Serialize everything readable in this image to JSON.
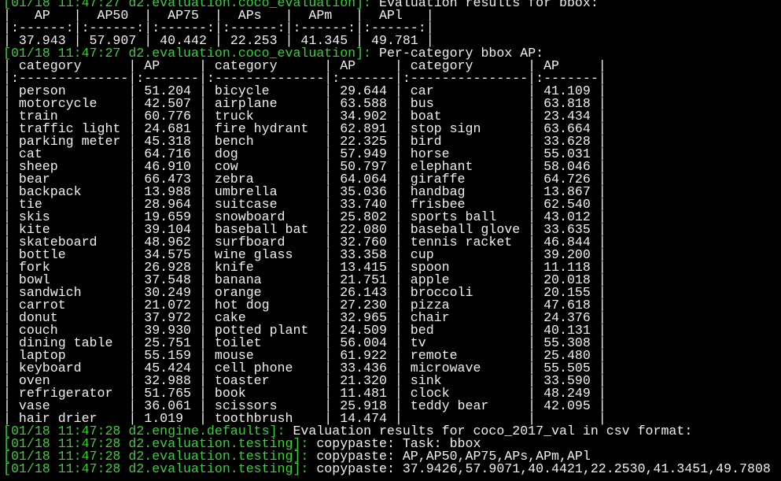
{
  "colors": {
    "background": "#000000",
    "log_prefix": "#3ccf3c",
    "text": "#f0f0f0"
  },
  "lines": [
    {
      "prefix": "[01/18 11:47:27 d2.evaluation.coco_evaluation]:",
      "text": " Evaluation results for bbox:"
    },
    {
      "prefix": "",
      "text": "|   AP   |  AP50  |  AP75  |  APs   |  APm   |  APl   |"
    },
    {
      "prefix": "",
      "text": "|:------:|:------:|:------:|:------:|:------:|:------:|"
    },
    {
      "prefix": "",
      "text": "| 37.943 | 57.907 | 40.442 | 22.253 | 41.345 | 49.781 |"
    },
    {
      "prefix": "[01/18 11:47:27 d2.evaluation.coco_evaluation]:",
      "text": " Per-category bbox AP:"
    },
    {
      "prefix": "",
      "text": "| category      | AP     | category      | AP     | category       | AP     |"
    },
    {
      "prefix": "",
      "text": "|:--------------|:-------|:--------------|:-------|:---------------|:-------|"
    },
    {
      "prefix": "",
      "text": "| person        | 51.204 | bicycle       | 29.644 | car            | 41.109 |"
    },
    {
      "prefix": "",
      "text": "| motorcycle    | 42.507 | airplane      | 63.588 | bus            | 63.818 |"
    },
    {
      "prefix": "",
      "text": "| train         | 60.776 | truck         | 34.902 | boat           | 23.434 |"
    },
    {
      "prefix": "",
      "text": "| traffic light | 24.681 | fire hydrant  | 62.891 | stop sign      | 63.664 |"
    },
    {
      "prefix": "",
      "text": "| parking meter | 45.318 | bench         | 22.325 | bird           | 33.628 |"
    },
    {
      "prefix": "",
      "text": "| cat           | 64.716 | dog           | 57.949 | horse          | 55.031 |"
    },
    {
      "prefix": "",
      "text": "| sheep         | 46.910 | cow           | 50.797 | elephant       | 58.046 |"
    },
    {
      "prefix": "",
      "text": "| bear          | 66.473 | zebra         | 64.064 | giraffe        | 64.726 |"
    },
    {
      "prefix": "",
      "text": "| backpack      | 13.988 | umbrella      | 35.036 | handbag        | 13.867 |"
    },
    {
      "prefix": "",
      "text": "| tie           | 28.964 | suitcase      | 33.740 | frisbee        | 62.540 |"
    },
    {
      "prefix": "",
      "text": "| skis          | 19.659 | snowboard     | 25.802 | sports ball    | 43.012 |"
    },
    {
      "prefix": "",
      "text": "| kite          | 39.104 | baseball bat  | 22.080 | baseball glove | 33.635 |"
    },
    {
      "prefix": "",
      "text": "| skateboard    | 48.962 | surfboard     | 32.760 | tennis racket  | 46.844 |"
    },
    {
      "prefix": "",
      "text": "| bottle        | 34.575 | wine glass    | 33.358 | cup            | 39.200 |"
    },
    {
      "prefix": "",
      "text": "| fork          | 26.928 | knife         | 13.415 | spoon          | 11.118 |"
    },
    {
      "prefix": "",
      "text": "| bowl          | 37.548 | banana        | 21.751 | apple          | 20.018 |"
    },
    {
      "prefix": "",
      "text": "| sandwich      | 30.249 | orange        | 26.143 | broccoli       | 20.155 |"
    },
    {
      "prefix": "",
      "text": "| carrot        | 21.072 | hot dog       | 27.230 | pizza          | 47.618 |"
    },
    {
      "prefix": "",
      "text": "| donut         | 37.972 | cake          | 32.965 | chair          | 24.376 |"
    },
    {
      "prefix": "",
      "text": "| couch         | 39.930 | potted plant  | 24.509 | bed            | 40.131 |"
    },
    {
      "prefix": "",
      "text": "| dining table  | 25.751 | toilet        | 56.004 | tv             | 55.308 |"
    },
    {
      "prefix": "",
      "text": "| laptop        | 55.159 | mouse         | 61.922 | remote         | 25.480 |"
    },
    {
      "prefix": "",
      "text": "| keyboard      | 45.424 | cell phone    | 33.436 | microwave      | 55.505 |"
    },
    {
      "prefix": "",
      "text": "| oven          | 32.988 | toaster       | 21.320 | sink           | 33.590 |"
    },
    {
      "prefix": "",
      "text": "| refrigerator  | 51.765 | book          | 11.481 | clock          | 48.249 |"
    },
    {
      "prefix": "",
      "text": "| vase          | 36.061 | scissors      | 25.918 | teddy bear     | 42.095 |"
    },
    {
      "prefix": "",
      "text": "| hair drier    | 1.019  | toothbrush    | 14.474 |                |        |"
    },
    {
      "prefix": "[01/18 11:47:28 d2.engine.defaults]:",
      "text": " Evaluation results for coco_2017_val in csv format:"
    },
    {
      "prefix": "[01/18 11:47:28 d2.evaluation.testing]:",
      "text": " copypaste: Task: bbox"
    },
    {
      "prefix": "[01/18 11:47:28 d2.evaluation.testing]:",
      "text": " copypaste: AP,AP50,AP75,APs,APm,APl"
    },
    {
      "prefix": "[01/18 11:47:28 d2.evaluation.testing]:",
      "text": " copypaste: 37.9426,57.9071,40.4421,22.2530,41.3451,49.7808"
    }
  ]
}
